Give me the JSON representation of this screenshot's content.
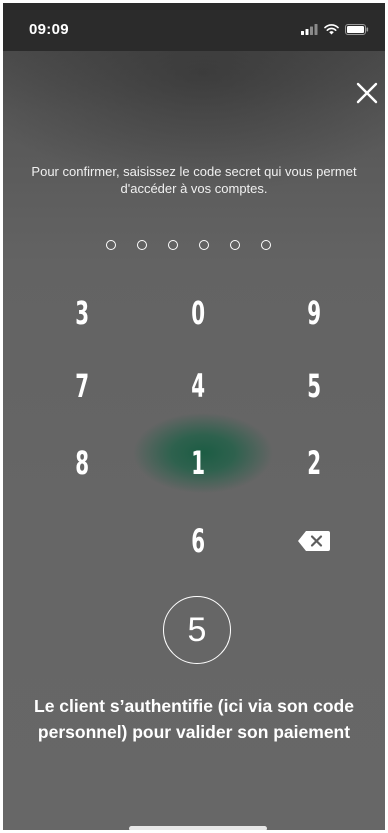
{
  "status_bar": {
    "time": "09:09",
    "icons": [
      "signal-icon",
      "wifi-icon",
      "battery-icon"
    ]
  },
  "header": {
    "close_icon": "close-icon"
  },
  "instruction": "Pour confirmer, saisissez le code secret qui vous permet d'accéder à vos comptes.",
  "pin": {
    "length": 6,
    "entered": 0
  },
  "keypad": {
    "rows": [
      [
        "3",
        "0",
        "9"
      ],
      [
        "7",
        "4",
        "5"
      ],
      [
        "8",
        "1",
        "2"
      ],
      [
        "",
        "6",
        "delete"
      ]
    ],
    "delete_icon": "backspace-icon"
  },
  "step": {
    "number": "5"
  },
  "caption": "Le client s’authentifie (ici via son code personnel) pour valider son paiement",
  "colors": {
    "background": "#666666",
    "status_bar": "#2b2b2b",
    "highlight_green": "#1e5f45",
    "text": "#ffffff"
  }
}
